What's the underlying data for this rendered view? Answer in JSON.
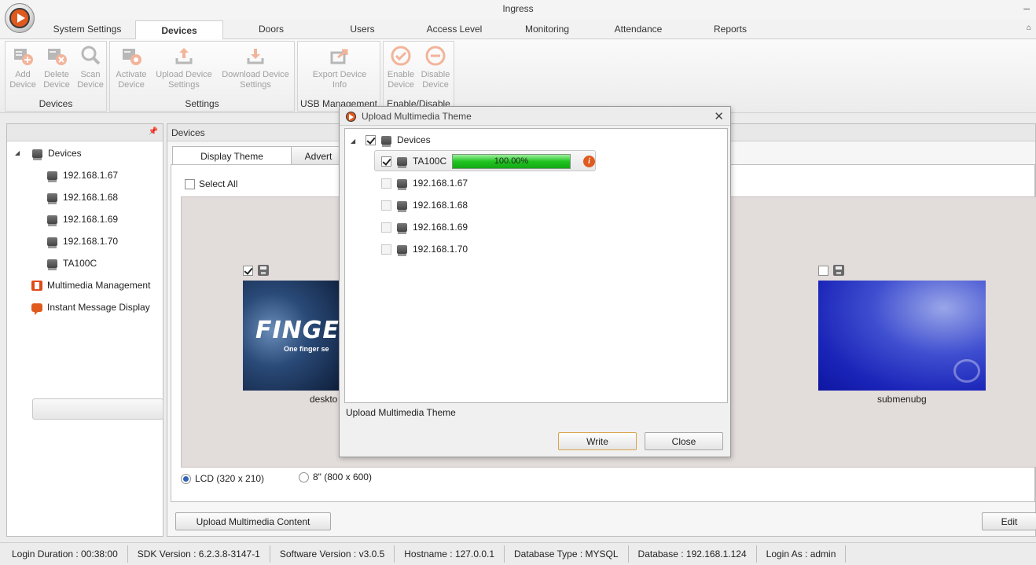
{
  "app": {
    "title": "Ingress",
    "minimize_label": "–"
  },
  "ribbon_tabs": [
    "System Settings",
    "Devices",
    "Doors",
    "Users",
    "Access Level",
    "Monitoring",
    "Attendance",
    "Reports"
  ],
  "ribbon": {
    "devices_group": {
      "label": "Devices",
      "add": [
        "Add",
        "Device"
      ],
      "delete": [
        "Delete",
        "Device"
      ],
      "scan": [
        "Scan",
        "Device"
      ]
    },
    "settings_group": {
      "label": "Settings",
      "activate": [
        "Activate",
        "Device"
      ],
      "upload": [
        "Upload Device",
        "Settings"
      ],
      "download": [
        "Download Device",
        "Settings"
      ]
    },
    "usb_group": {
      "label": "USB Management",
      "export": [
        "Export Device",
        "Info"
      ]
    },
    "enable_group": {
      "label": "Enable/Disable",
      "enable": [
        "Enable",
        "Device"
      ],
      "disable": [
        "Disable",
        "Device"
      ]
    }
  },
  "left_panel": {
    "pin_icon": "pin-icon",
    "tree_root": "Devices",
    "devices": [
      "192.168.1.67",
      "192.168.1.68",
      "192.168.1.69",
      "192.168.1.70",
      "TA100C"
    ],
    "multimedia": "Multimedia Management",
    "instant_message": "Instant Message Display"
  },
  "main_panel": {
    "header": "Devices",
    "tabs": [
      "Display Theme",
      "Advert"
    ],
    "select_all": "Select All",
    "thumbnails": [
      {
        "caption": "deskto",
        "logo_text": "FINGE",
        "tagline": "One finger se",
        "checked": true
      },
      {
        "caption": "submenubg",
        "checked": false
      }
    ],
    "radios": [
      "LCD (320 x 210)",
      "8\" (800 x 600)"
    ],
    "upload_button": "Upload Multimedia Content",
    "edit_button": "Edit"
  },
  "status_bar": [
    "Login Duration : 00:38:00",
    "SDK Version : 6.2.3.8-3147-1",
    "Software Version : v3.0.5",
    "Hostname : 127.0.0.1",
    "Database Type : MYSQL",
    "Database : 192.168.1.124",
    "Login As : admin"
  ],
  "dialog": {
    "title": "Upload Multimedia Theme",
    "close_glyph": "✕",
    "tree_root": "Devices",
    "selected_device": "TA100C",
    "progress_text": "100.00%",
    "progress_fraction": 1.0,
    "other_devices": [
      "192.168.1.67",
      "192.168.1.68",
      "192.168.1.69",
      "192.168.1.70"
    ],
    "status_text": "Upload Multimedia Theme",
    "write_button": "Write",
    "close_button": "Close",
    "info_glyph": "i"
  },
  "colors": {
    "accent": "#e05a1e",
    "progress": "#1fc41f",
    "gallery_bg": "#e2dcda"
  }
}
